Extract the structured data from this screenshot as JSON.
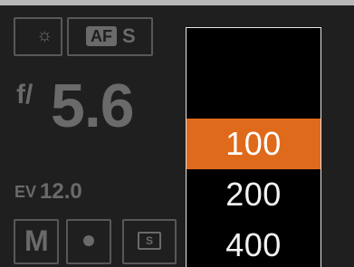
{
  "colors": {
    "accent": "#e06a1b",
    "background": "#1f1f1f",
    "muted_text": "#6a6a6a"
  },
  "status": {
    "white_balance_icon": "sun-icon",
    "af_label": "AF",
    "af_mode": "S",
    "fstop_prefix": "f/",
    "fstop_value": "5.6",
    "ev_label": "EV",
    "ev_value": "12.0",
    "shooting_mode": "M",
    "metering_icon": "dot-icon",
    "drive_label": "S"
  },
  "dropdown": {
    "options": [
      "100",
      "200",
      "400"
    ],
    "selected": "100"
  }
}
